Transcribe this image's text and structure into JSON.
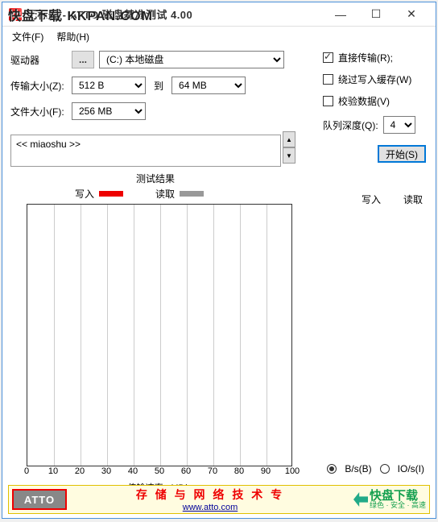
{
  "watermark": "快盘下载 KKPAN.COM",
  "titlebar": {
    "title": "无标题 - ATTO 磁盘基准测试 4.00",
    "min": "—",
    "max": "☐",
    "close": "✕"
  },
  "menu": {
    "file": "文件(F)",
    "help": "帮助(H)"
  },
  "labels": {
    "drive": "驱动器",
    "transfer_size": "传输大小(Z):",
    "file_size": "文件大小(F):",
    "to": "到",
    "browse": "...",
    "queue_depth": "队列深度(Q):",
    "results": "测试结果",
    "write": "写入",
    "read": "读取",
    "xaxis": "传输速率 - MB/s"
  },
  "drive_value": "(C:) 本地磁盘",
  "transfer_min": "512 B",
  "transfer_max": "64 MB",
  "file_size_value": "256 MB",
  "checkboxes": {
    "direct": {
      "label": "直接传输(R);",
      "checked": true
    },
    "bypass": {
      "label": "绕过写入缓存(W)",
      "checked": false
    },
    "verify": {
      "label": "校验数据(V)",
      "checked": false
    }
  },
  "queue_value": "4",
  "start_btn": "开始(S)",
  "desc_text": "<< miaoshu >>",
  "columns": {
    "write": "写入",
    "read": "读取"
  },
  "radios": {
    "bs": "B/s(B)",
    "ios": "IO/s(I)"
  },
  "banner": {
    "atto": "ATTO",
    "cn": "存 储 与 网 络 技 术 专",
    "url": "www.atto.com",
    "kp_main": "快盘下载",
    "kp_sub": "绿色 · 安全 · 高速"
  },
  "chart_data": {
    "type": "bar",
    "categories": [],
    "series": [
      {
        "name": "写入",
        "values": []
      },
      {
        "name": "读取",
        "values": []
      }
    ],
    "xlabel": "传输速率 - MB/s",
    "xlim": [
      0,
      100
    ],
    "xticks": [
      0,
      10,
      20,
      30,
      40,
      50,
      60,
      70,
      80,
      90,
      100
    ],
    "title": "测试结果"
  }
}
